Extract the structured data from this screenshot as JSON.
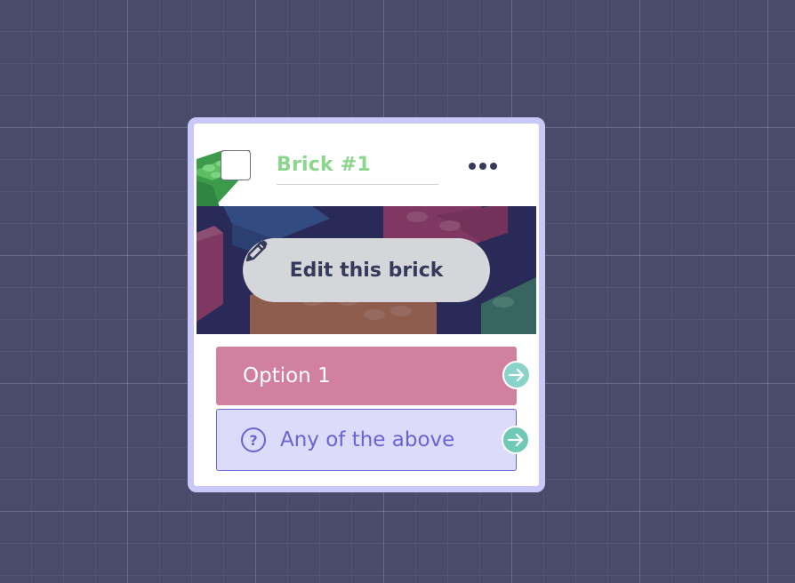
{
  "brick": {
    "title": "Brick #1",
    "edit_label": "Edit this brick",
    "menu_icon": "more-horizontal-icon",
    "edit_icon": "pencil-icon",
    "options": [
      {
        "label": "Option 1",
        "color": "#d2809f"
      },
      {
        "label": "Any of the above",
        "icon": "question-circle-icon",
        "color": "#dcdcfa"
      }
    ]
  },
  "colors": {
    "background": "#484b6a",
    "card_border": "#c9c8f6",
    "title": "#8bd58d",
    "text_dark": "#353a5a",
    "connector": "#6fc9b6"
  }
}
